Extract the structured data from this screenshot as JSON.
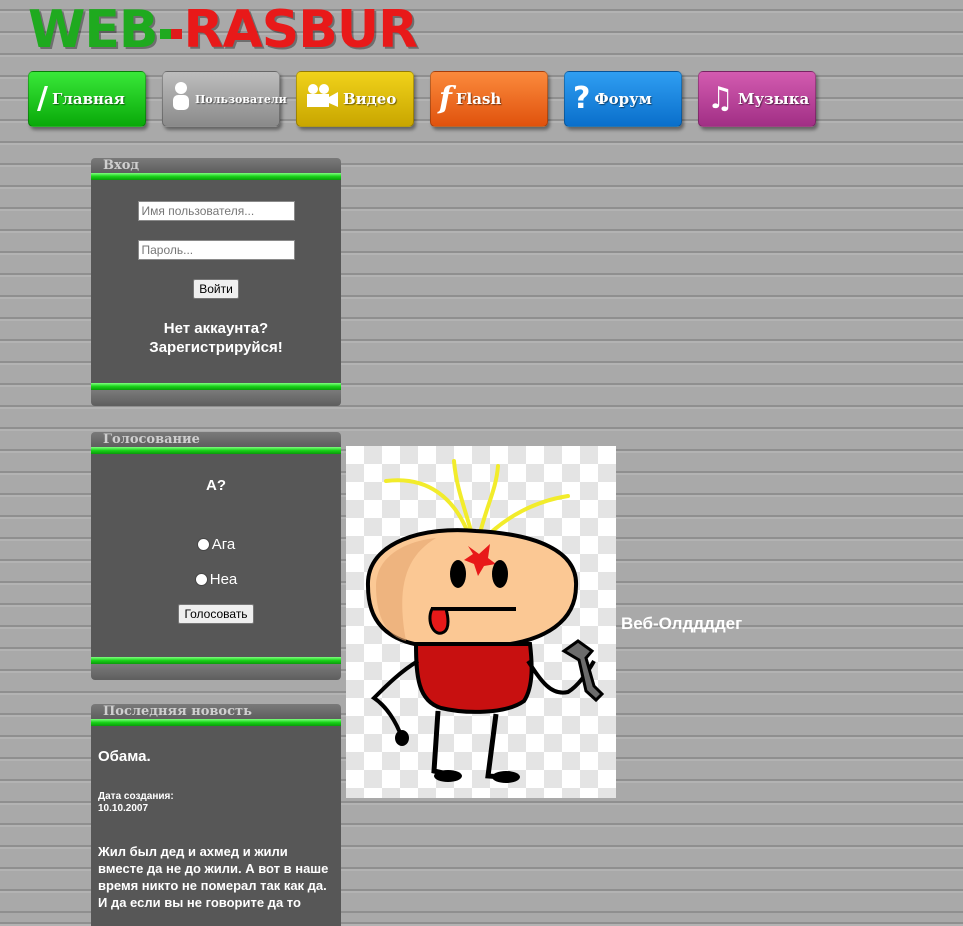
{
  "logo": {
    "part1": "WEB",
    "part2": "RASBUR"
  },
  "nav": [
    {
      "label": "Главная",
      "icon": "slash-icon"
    },
    {
      "label": "Пользователи",
      "icon": "user-icon"
    },
    {
      "label": "Видео",
      "icon": "camera-icon"
    },
    {
      "label": "Flash",
      "icon": "flash-icon"
    },
    {
      "label": "Форум",
      "icon": "question-icon"
    },
    {
      "label": "Музыка",
      "icon": "music-note-icon"
    }
  ],
  "login": {
    "title": "Вход",
    "username_placeholder": "Имя пользователя...",
    "password_placeholder": "Пароль...",
    "submit_label": "Войти",
    "register_line1": "Нет аккаунта?",
    "register_line2": "Зарегистрируйся!"
  },
  "poll": {
    "title": "Голосование",
    "question": "А?",
    "options": [
      "Ага",
      "Неа"
    ],
    "submit_label": "Голосовать"
  },
  "news": {
    "title": "Последняя новость",
    "headline": "Обама.",
    "date_label": "Дата создания:",
    "date": "10.10.2007",
    "body": "Жил был дед и ахмед и жили вместе да не до жили. А вот в наше время никто не померал так как да. И да если вы не говорите да то"
  },
  "image_caption": "Веб-Олддддег",
  "colors": {
    "accent_green": "#17d017",
    "panel_bg": "#575757"
  }
}
